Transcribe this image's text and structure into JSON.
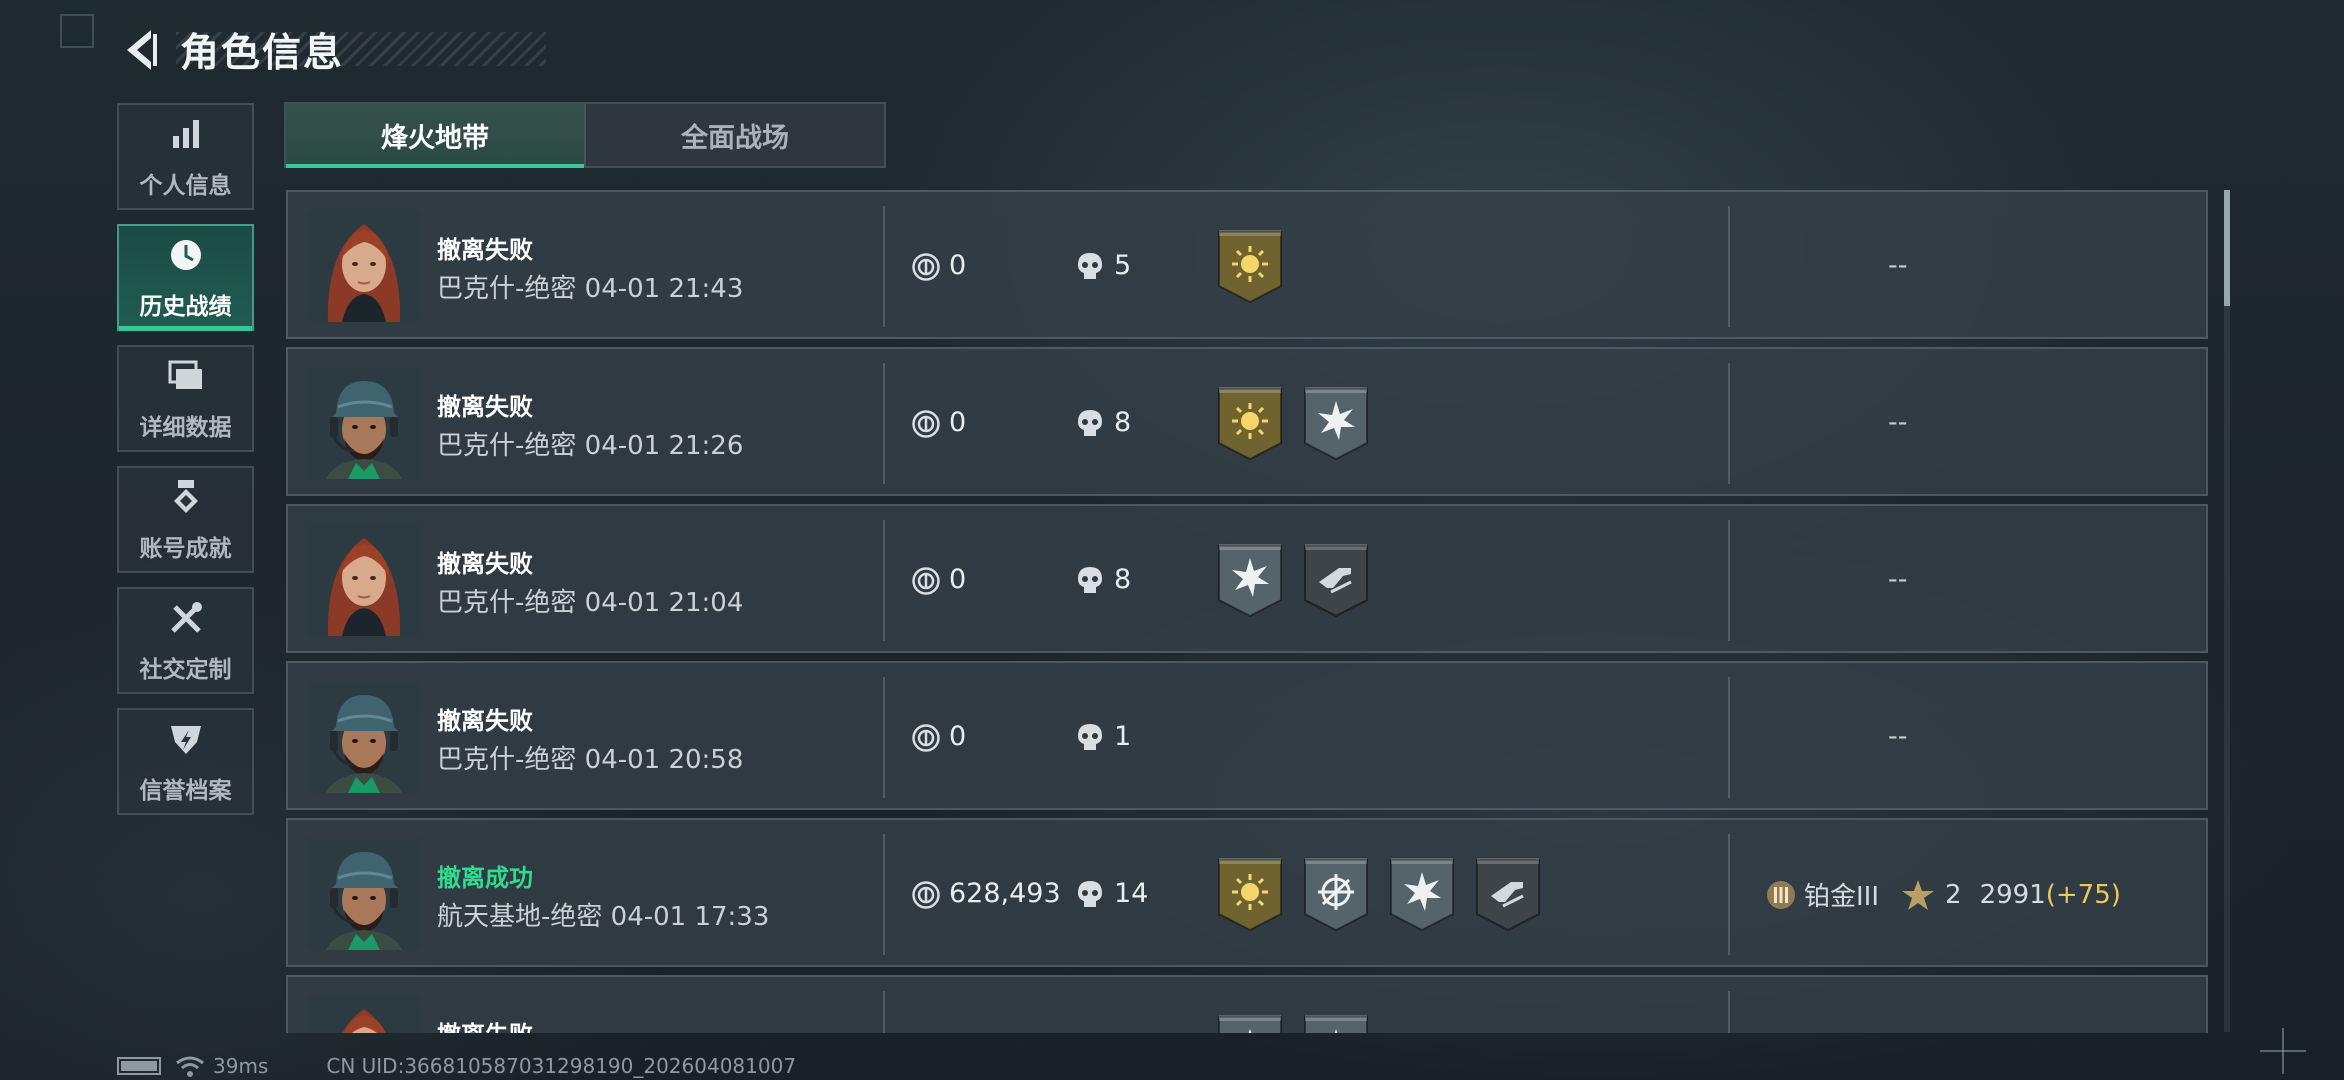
{
  "header": {
    "title": "角色信息",
    "back_icon": "back-arrow-icon"
  },
  "side_nav": [
    {
      "label": "个人信息",
      "icon": "bar-chart-icon",
      "active": false
    },
    {
      "label": "历史战绩",
      "icon": "clock-icon",
      "active": true
    },
    {
      "label": "详细数据",
      "icon": "folders-icon",
      "active": false
    },
    {
      "label": "账号成就",
      "icon": "medal-icon",
      "active": false
    },
    {
      "label": "社交定制",
      "icon": "tools-icon",
      "active": false
    },
    {
      "label": "信誉档案",
      "icon": "shield-icon",
      "active": false
    }
  ],
  "tabs": [
    {
      "label": "烽火地带",
      "active": true
    },
    {
      "label": "全面战场",
      "active": false
    }
  ],
  "matches": [
    {
      "result": "撤离失败",
      "success": false,
      "map_time": "巴克什-绝密 04-01 21:43",
      "avatar": "female-operator",
      "money": "0",
      "kills": "5",
      "medals": [
        "gold-sun"
      ],
      "rank": "--"
    },
    {
      "result": "撤离失败",
      "success": false,
      "map_time": "巴克什-绝密 04-01 21:26",
      "avatar": "male-operator",
      "money": "0",
      "kills": "8",
      "medals": [
        "gold-sun",
        "silver-burst"
      ],
      "rank": "--"
    },
    {
      "result": "撤离失败",
      "success": false,
      "map_time": "巴克什-绝密 04-01 21:04",
      "avatar": "female-operator",
      "money": "0",
      "kills": "8",
      "medals": [
        "silver-burst",
        "dark-gun"
      ],
      "rank": "--"
    },
    {
      "result": "撤离失败",
      "success": false,
      "map_time": "巴克什-绝密 04-01 20:58",
      "avatar": "male-operator",
      "money": "0",
      "kills": "1",
      "medals": [],
      "rank": "--"
    },
    {
      "result": "撤离成功",
      "success": true,
      "map_time": "航天基地-绝密 04-01 17:33",
      "avatar": "male-operator",
      "money": "628,493",
      "kills": "14",
      "medals": [
        "gold-sun",
        "silver-target",
        "silver-burst",
        "dark-gun"
      ],
      "rank_tier": "铂金III",
      "stars": "2",
      "score": "2991",
      "delta": "(+75)"
    },
    {
      "result": "撤离失败",
      "success": false,
      "map_time": "",
      "avatar": "female-operator",
      "money": "",
      "kills": "",
      "medals": [
        "silver-star",
        "silver-burst"
      ],
      "rank": ""
    }
  ],
  "status_bar": {
    "ping": "39ms",
    "uid": "CN UID:366810587031298190_202604081007"
  },
  "colors": {
    "accent": "#34c89a",
    "success": "#2fdc8e",
    "delta": "#f0c75a",
    "gold_medal": "#b49a3a"
  }
}
